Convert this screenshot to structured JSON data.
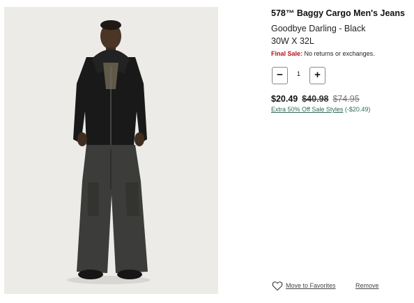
{
  "product": {
    "image_alt": "Model wearing 578 Baggy Cargo Men's Jeans",
    "title": "578™ Baggy Cargo Men's Jeans",
    "color": "Goodbye Darling - Black",
    "size": "30W X 32L",
    "final_sale_label": "Final Sale:",
    "final_sale_text": "No returns or exchanges."
  },
  "quantity": {
    "minus_label": "−",
    "value": "1",
    "plus_label": "+"
  },
  "pricing": {
    "sale_price": "$20.49",
    "was_price": "$40.98",
    "original_price": "$74.95",
    "promo_link": "Extra 50% Off Sale Styles",
    "promo_savings": "(-$20.49)"
  },
  "actions": {
    "favorites_label": "Move to Favorites",
    "remove_label": "Remove"
  },
  "colors": {
    "final_sale": "#b5121b",
    "promo": "#2e6b4f"
  }
}
